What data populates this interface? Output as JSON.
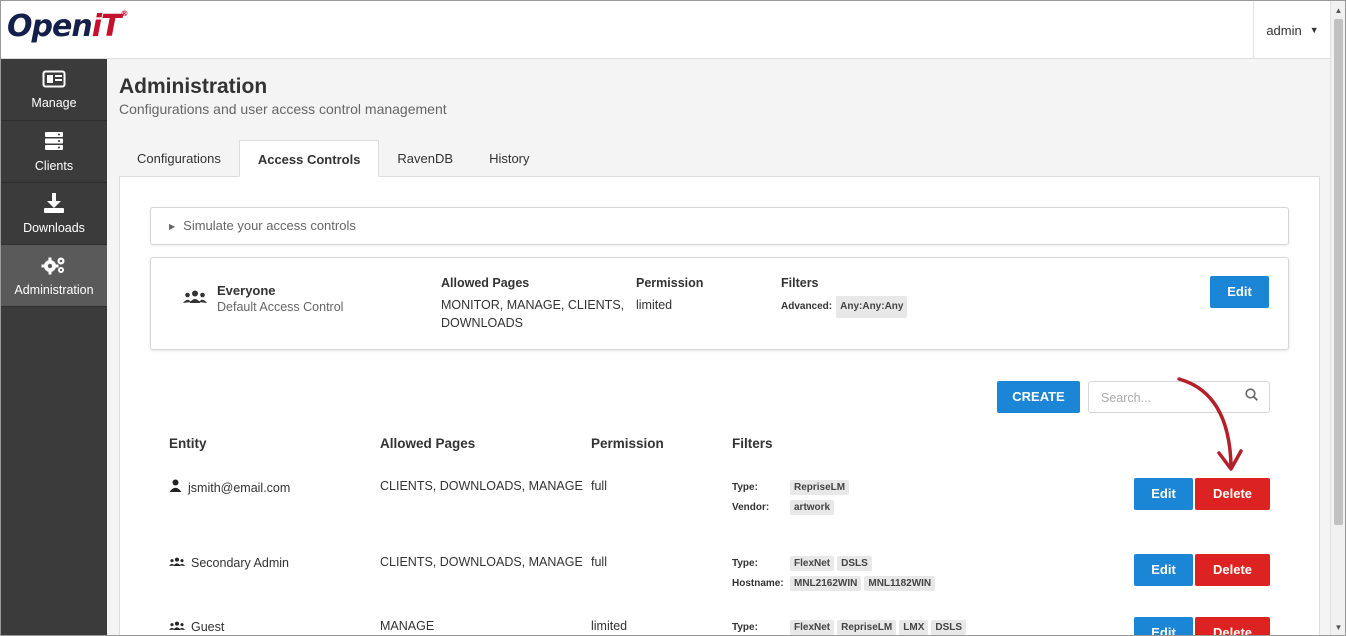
{
  "header": {
    "logo_text": "Open",
    "logo_text_accent": "iT",
    "logo_reg": "®",
    "user": "admin"
  },
  "sidebar": {
    "items": [
      {
        "label": "Manage",
        "icon": "id-card-icon"
      },
      {
        "label": "Clients",
        "icon": "server-icon"
      },
      {
        "label": "Downloads",
        "icon": "download-icon"
      },
      {
        "label": "Administration",
        "icon": "gears-icon",
        "active": true
      }
    ]
  },
  "page": {
    "title": "Administration",
    "subtitle": "Configurations and user access control management"
  },
  "tabs": [
    "Configurations",
    "Access Controls",
    "RavenDB",
    "History"
  ],
  "active_tab": "Access Controls",
  "simulate": {
    "label": "Simulate your access controls"
  },
  "default_card": {
    "name": "Everyone",
    "description": "Default Access Control",
    "allowed_pages_header": "Allowed Pages",
    "allowed_pages_line1": "MONITOR, MANAGE, CLIENTS,",
    "allowed_pages_line2": "DOWNLOADS",
    "permission_header": "Permission",
    "permission": "limited",
    "filters_header": "Filters",
    "filter_label": "Advanced:",
    "filter_value": "Any:Any:Any",
    "edit_label": "Edit"
  },
  "toolbar": {
    "create_label": "CREATE",
    "search_placeholder": "Search..."
  },
  "table": {
    "headers": [
      "Entity",
      "Allowed Pages",
      "Permission",
      "Filters"
    ],
    "rows": [
      {
        "entity": "jsmith@email.com",
        "entity_icon": "user-icon",
        "allowed_pages": "CLIENTS, DOWNLOADS, MANAGE",
        "permission": "full",
        "filters": [
          {
            "label": "Type:",
            "tags": [
              "RepriseLM"
            ]
          },
          {
            "label": "Vendor:",
            "tags": [
              "artwork"
            ]
          }
        ],
        "edit_label": "Edit",
        "delete_label": "Delete"
      },
      {
        "entity": "Secondary Admin",
        "entity_icon": "users-icon",
        "allowed_pages": "CLIENTS, DOWNLOADS, MANAGE",
        "permission": "full",
        "filters": [
          {
            "label": "Type:",
            "tags": [
              "FlexNet",
              "DSLS"
            ]
          },
          {
            "label": "Hostname:",
            "tags": [
              "MNL2162WIN",
              "MNL1182WIN"
            ]
          }
        ],
        "edit_label": "Edit",
        "delete_label": "Delete"
      },
      {
        "entity": "Guest",
        "entity_icon": "users-icon",
        "allowed_pages": "MANAGE",
        "permission": "limited",
        "filters": [
          {
            "label": "Type:",
            "tags": [
              "FlexNet",
              "RepriseLM",
              "LMX",
              "DSLS"
            ]
          }
        ],
        "edit_label": "Edit",
        "delete_label": "Delete"
      }
    ]
  },
  "colors": {
    "primary": "#1b86d6",
    "danger": "#dd2222",
    "sidebar": "#3b3b3b",
    "annotation_arrow": "#b3202a"
  }
}
